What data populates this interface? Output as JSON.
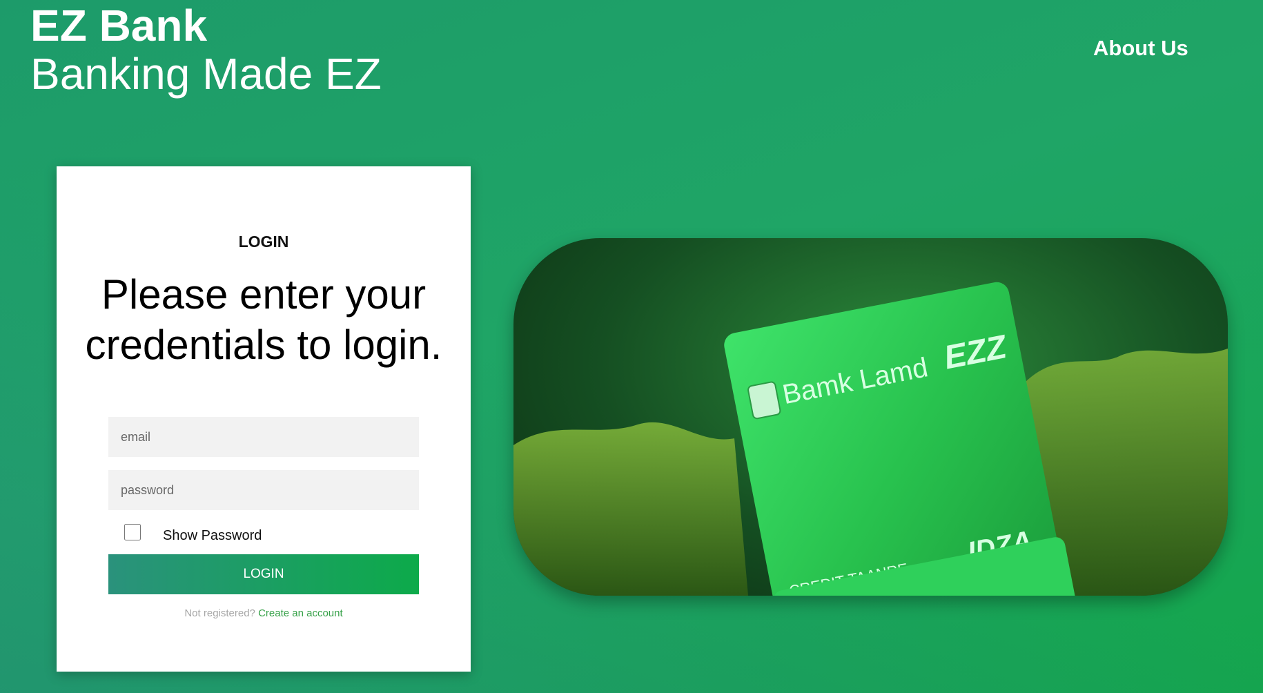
{
  "header": {
    "brand_name": "EZ Bank",
    "tagline": "Banking Made EZ",
    "nav": {
      "about_label": "About Us"
    }
  },
  "login": {
    "heading": "LOGIN",
    "prompt": "Please enter your credentials to login.",
    "email_placeholder": "email",
    "password_placeholder": "password",
    "show_password_label": "Show Password",
    "show_password_checked": false,
    "submit_label": "LOGIN",
    "register_prompt": "Not registered?",
    "register_link": "Create an account"
  },
  "hero": {
    "card_text": "Bamk Lamd",
    "card_logo": "EZZ",
    "card_caption": "CREDIT TAANRE",
    "card_brand": "IDZA"
  },
  "colors": {
    "background_start": "#1d9b6a",
    "background_end": "#14a64c",
    "button_start": "#2a927c",
    "button_end": "#0daa4a",
    "link": "#36a148"
  }
}
